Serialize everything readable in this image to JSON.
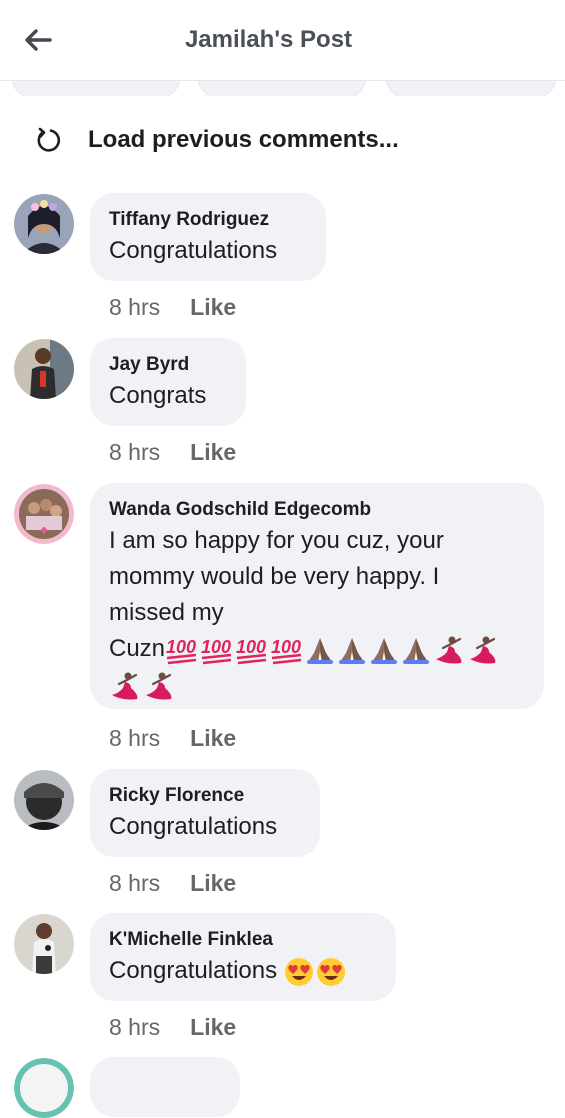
{
  "header": {
    "title": "Jamilah's Post",
    "back_icon": "arrow-left-icon"
  },
  "load_previous": {
    "label": "Load previous comments...",
    "icon": "refresh-icon"
  },
  "comments": [
    {
      "author": "Tiffany Rodriguez",
      "text": "Congratulations",
      "time": "8 hrs",
      "like": "Like"
    },
    {
      "author": "Jay Byrd",
      "text": "Congrats",
      "time": "8 hrs",
      "like": "Like"
    },
    {
      "author": "Wanda Godschild Edgecomb",
      "text_line1": "I am so happy for you cuz, your",
      "text_line2": "mommy would be very happy. I",
      "text_line3": "missed my",
      "text_line4": "Cuzn",
      "emojis": [
        "hundred-points",
        "hundred-points",
        "hundred-points",
        "hundred-points",
        "folded-hands",
        "folded-hands",
        "folded-hands",
        "folded-hands",
        "woman-dancing",
        "woman-dancing",
        "woman-dancing",
        "woman-dancing"
      ],
      "time": "8 hrs",
      "like": "Like"
    },
    {
      "author": "Ricky Florence",
      "text": "Congratulations",
      "time": "8 hrs",
      "like": "Like"
    },
    {
      "author": "K'Michelle Finklea",
      "text": "Congratulations",
      "emojis": [
        "heart-eyes",
        "heart-eyes"
      ],
      "time": "8 hrs",
      "like": "Like"
    }
  ],
  "colors": {
    "bubble": "#f0f2f5",
    "meta_text": "#65676b",
    "title_text": "#4b4f56",
    "hundred_red": "#e0245e",
    "hands": "#8d6e63",
    "dancer_dress": "#d81b60",
    "emoji_yellow": "#ffcc33"
  }
}
